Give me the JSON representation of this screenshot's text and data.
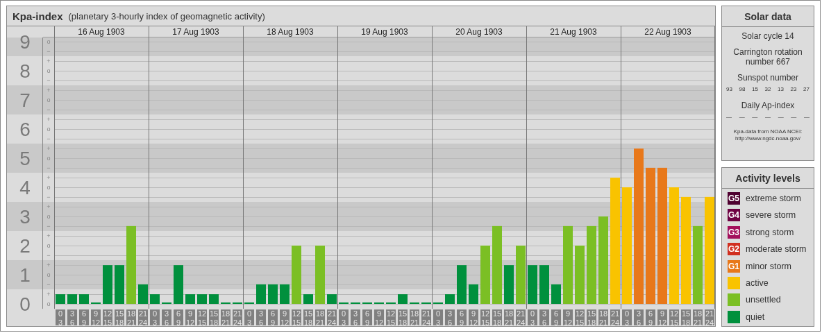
{
  "header": {
    "title": "Kpa-index",
    "subtitle": "(planetary 3-hourly index of geomagnetic activity)"
  },
  "day_headers": [
    "16 Aug 1903",
    "17 Aug 1903",
    "18 Aug 1903",
    "19 Aug 1903",
    "20 Aug 1903",
    "21 Aug 1903",
    "22 Aug 1903"
  ],
  "chart_data": {
    "type": "bar",
    "ylim": [
      -0.17,
      9.14
    ],
    "grid": true,
    "categories": [
      "0\n3",
      "3\n6",
      "6\n9",
      "9\n12",
      "12\n15",
      "15\n18",
      "18\n21",
      "21\n24",
      "0\n3",
      "3\n6",
      "6\n9",
      "9\n12",
      "12\n15",
      "15\n18",
      "18\n21",
      "21\n24",
      "0\n3",
      "3\n6",
      "6\n9",
      "9\n12",
      "12\n15",
      "15\n18",
      "18\n21",
      "21\n24",
      "0\n3",
      "3\n6",
      "6\n9",
      "9\n12",
      "12\n15",
      "15\n18",
      "18\n21",
      "21\n24",
      "0\n3",
      "3\n6",
      "6\n9",
      "9\n12",
      "12\n15",
      "15\n18",
      "18\n21",
      "21\n24",
      "0\n3",
      "3\n6",
      "6\n9",
      "9\n12",
      "12\n15",
      "15\n18",
      "18\n21",
      "21\n24",
      "0\n3",
      "3\n6",
      "6\n9",
      "9\n12",
      "12\n15",
      "15\n18",
      "18\n21",
      "21\n24"
    ],
    "series": [
      {
        "values": [
          0.33,
          0.33,
          0.33,
          0,
          1.33,
          1.33,
          2.67,
          0.67,
          0.33,
          0,
          1.33,
          0.33,
          0.33,
          0.33,
          0,
          0,
          0,
          0.67,
          0.67,
          0.67,
          2,
          0.33,
          2,
          0.33,
          0,
          0,
          0,
          0,
          0,
          0.33,
          0,
          0,
          0,
          0.33,
          1.33,
          0.67,
          2,
          2.67,
          1.33,
          2,
          1.33,
          1.33,
          0.67,
          2.67,
          2,
          2.67,
          3,
          4.33,
          4,
          5.33,
          4.67,
          4.67,
          4,
          3.67,
          2.67,
          3.67
        ]
      }
    ],
    "yticks": [
      0,
      1,
      2,
      3,
      4,
      5,
      6,
      7,
      8,
      9
    ]
  },
  "y_minor_marks": [
    "o",
    "−",
    "+",
    "o",
    "−",
    "+",
    "o",
    "−",
    "+",
    "o",
    "−",
    "+",
    "o",
    "−",
    "+",
    "o",
    "−",
    "+",
    "o",
    "−",
    "+",
    "o",
    "−",
    "+",
    "o",
    "−",
    "+",
    "o"
  ],
  "solar_data": {
    "title": "Solar data",
    "solar_cycle": "Solar cycle 14",
    "carrington": "Carrington rotation number 667",
    "sunspot_label": "Sunspot number",
    "sunspot_numbers": [
      "93",
      "98",
      "15",
      "32",
      "13",
      "23",
      "27"
    ],
    "ap_label": "Daily Ap-index",
    "ap_values": [
      "—",
      "—",
      "—",
      "—",
      "—",
      "—",
      "—"
    ],
    "source": "Kpa-data from NOAA NCEI:",
    "source_url": "http://www.ngdc.noaa.gov/"
  },
  "legend": {
    "title": "Activity levels",
    "items": [
      {
        "kind": "storm",
        "code": "G5",
        "label": "extreme storm",
        "color": "#4f0030"
      },
      {
        "kind": "storm",
        "code": "G4",
        "label": "severe storm",
        "color": "#6e0142"
      },
      {
        "kind": "storm",
        "code": "G3",
        "label": "strong storm",
        "color": "#a3105c"
      },
      {
        "kind": "storm",
        "code": "G2",
        "label": "moderate storm",
        "color": "#d12f20"
      },
      {
        "kind": "storm",
        "code": "G1",
        "label": "minor storm",
        "color": "#e8781a"
      },
      {
        "kind": "level",
        "label": "active",
        "color": "#f9c300"
      },
      {
        "kind": "level",
        "label": "unsettled",
        "color": "#7bbf24"
      },
      {
        "kind": "level",
        "label": "quiet",
        "color": "#00903d"
      }
    ]
  }
}
